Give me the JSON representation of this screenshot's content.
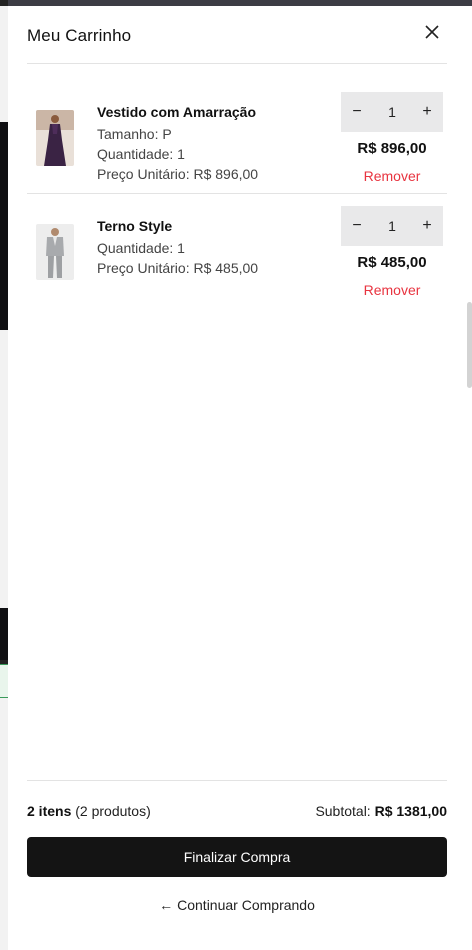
{
  "cart": {
    "title": "Meu Carrinho"
  },
  "items": [
    {
      "name": "Vestido com Amarração",
      "size": "Tamanho: P",
      "quantity_text": "Quantidade: 1",
      "unit_price": "Preço Unitário: R$ 896,00",
      "qty_value": "1",
      "total": "R$ 896,00",
      "remove_label": "Remover"
    },
    {
      "name": "Terno Style",
      "quantity_text": "Quantidade: 1",
      "unit_price": "Preço Unitário: R$ 485,00",
      "qty_value": "1",
      "total": "R$ 485,00",
      "remove_label": "Remover"
    }
  ],
  "qty_controls": {
    "minus": "−",
    "plus": "+"
  },
  "summary": {
    "items_count": "2 itens",
    "products_count": "(2 produtos)",
    "subtotal_label": "Subtotal:",
    "subtotal_value": "R$ 1381,00"
  },
  "actions": {
    "checkout_label": "Finalizar Compra",
    "continue_arrow": "←",
    "continue_label": "Continuar Comprando"
  },
  "colors": {
    "accent_remove": "#e8333f",
    "checkout_bg": "#141414",
    "qty_bg": "#e9e9ea"
  }
}
